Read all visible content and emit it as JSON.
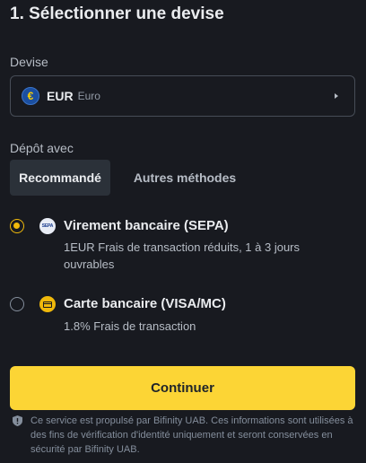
{
  "header": {
    "title": "1. Sélectionner une devise"
  },
  "currency": {
    "section_label": "Devise",
    "selected_code": "EUR",
    "selected_name": "Euro",
    "icon_glyph": "€"
  },
  "deposit": {
    "section_label": "Dépôt avec",
    "tabs": [
      {
        "label": "Recommandé",
        "active": true
      },
      {
        "label": "Autres méthodes",
        "active": false
      }
    ],
    "methods": [
      {
        "title": "Virement bancaire (SEPA)",
        "description": "1EUR Frais de transaction réduits, 1 à 3 jours ouvrables",
        "icon": "sepa-icon",
        "icon_text": "SEPA",
        "selected": true
      },
      {
        "title": "Carte bancaire (VISA/MC)",
        "description": "1.8% Frais de transaction",
        "icon": "credit-card-icon",
        "selected": false
      }
    ]
  },
  "actions": {
    "continue_label": "Continuer"
  },
  "footer": {
    "notice": "Ce service est propulsé par Bifinity UAB. Ces informations sont utilisées à des fins de vérification d'identité uniquement et seront conservées en sécurité par Bifinity UAB.",
    "icon": "shield-icon"
  },
  "colors": {
    "background": "#181a20",
    "accent": "#fcd535",
    "radio_selected": "#f0b90b",
    "tab_active_bg": "#2b3139"
  }
}
